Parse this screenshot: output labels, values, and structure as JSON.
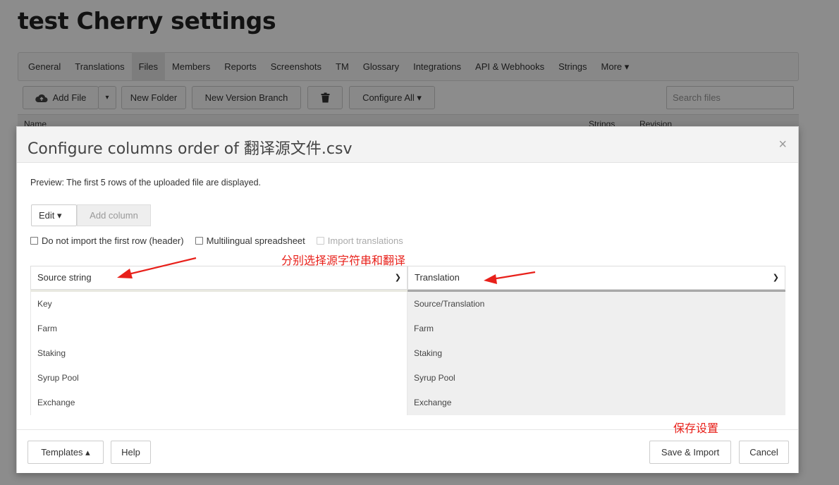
{
  "page": {
    "title": "test Cherry settings"
  },
  "nav": {
    "items": [
      "General",
      "Translations",
      "Files",
      "Members",
      "Reports",
      "Screenshots",
      "TM",
      "Glossary",
      "Integrations",
      "API & Webhooks",
      "Strings",
      "More ▾"
    ],
    "active": "Files"
  },
  "toolbar": {
    "add_file": "Add File",
    "dropdown_caret": "▾",
    "new_folder": "New Folder",
    "new_version_branch": "New Version Branch",
    "configure_all": "Configure All ▾",
    "search_placeholder": "Search files"
  },
  "table_header": {
    "name": "Name",
    "strings": "Strings",
    "revision": "Revision"
  },
  "modal": {
    "title": "Configure columns order of 翻译源文件.csv",
    "close": "×",
    "preview_text": "Preview: The first 5 rows of the uploaded file are displayed.",
    "edit_label": "Edit ▾",
    "add_column_label": "Add column",
    "options": [
      {
        "label": "Do not import the first row (header)",
        "disabled": false
      },
      {
        "label": "Multilingual spreadsheet",
        "disabled": false
      },
      {
        "label": "Import translations",
        "disabled": true
      }
    ],
    "columns": [
      {
        "selected": "Source string",
        "accent": "#e8e8e0"
      },
      {
        "selected": "Translation",
        "accent": "#a8a8a8"
      }
    ],
    "rows": [
      [
        "Key",
        "Source/Translation"
      ],
      [
        "Farm",
        "Farm"
      ],
      [
        "Staking",
        "Staking"
      ],
      [
        "Syrup Pool",
        "Syrup Pool"
      ],
      [
        "Exchange",
        "Exchange"
      ]
    ],
    "footer": {
      "templates": "Templates ▴",
      "help": "Help",
      "save_import": "Save & Import",
      "cancel": "Cancel"
    }
  },
  "annotations": {
    "select_hint": "分别选择源字符串和翻译",
    "save_hint": "保存设置",
    "color": "#e8201a"
  }
}
